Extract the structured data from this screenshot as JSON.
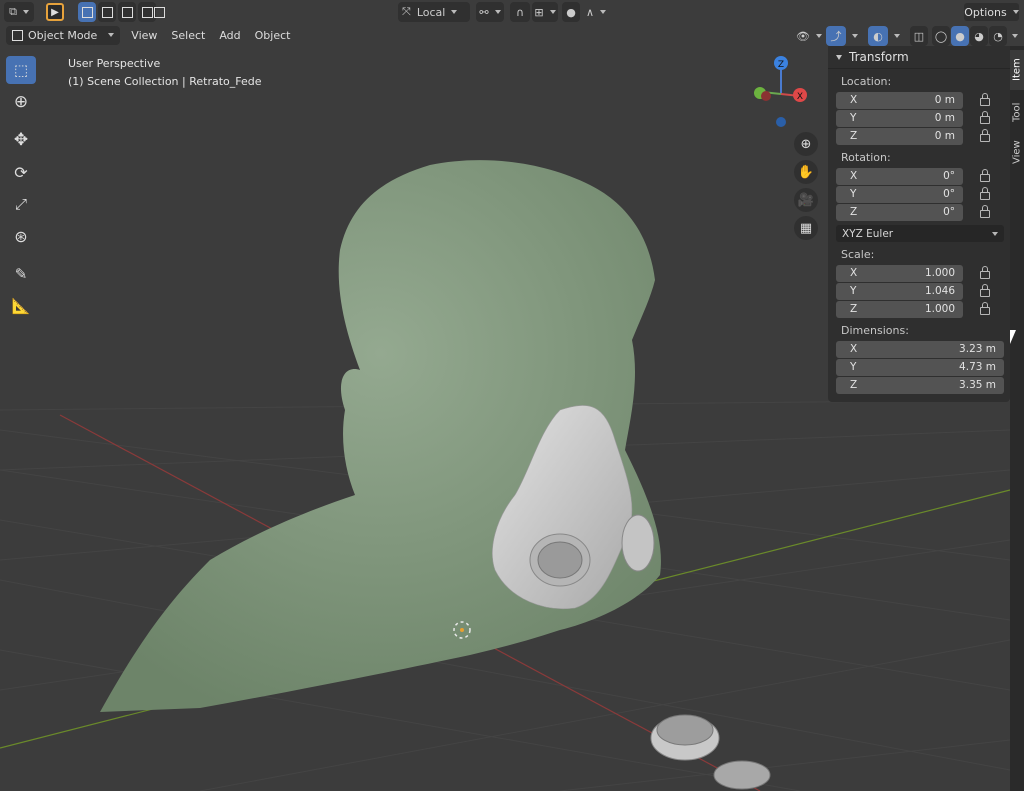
{
  "header": {
    "transform_orientation": "Local",
    "options_label": "Options"
  },
  "menubar": {
    "mode": "Object Mode",
    "items": [
      "View",
      "Select",
      "Add",
      "Object"
    ]
  },
  "overlay": {
    "perspective": "User Perspective",
    "collection": "(1) Scene Collection | Retrato_Fede"
  },
  "gizmo": {
    "z_label": "Z",
    "y_label": "Y",
    "x_label": "X"
  },
  "transform": {
    "title": "Transform",
    "location_label": "Location:",
    "location": [
      {
        "axis": "X",
        "value": "0 m"
      },
      {
        "axis": "Y",
        "value": "0 m"
      },
      {
        "axis": "Z",
        "value": "0 m"
      }
    ],
    "rotation_label": "Rotation:",
    "rotation": [
      {
        "axis": "X",
        "value": "0°"
      },
      {
        "axis": "Y",
        "value": "0°"
      },
      {
        "axis": "Z",
        "value": "0°"
      }
    ],
    "rotation_mode": "XYZ Euler",
    "scale_label": "Scale:",
    "scale": [
      {
        "axis": "X",
        "value": "1.000"
      },
      {
        "axis": "Y",
        "value": "1.046"
      },
      {
        "axis": "Z",
        "value": "1.000"
      }
    ],
    "dimensions_label": "Dimensions:",
    "dimensions": [
      {
        "axis": "X",
        "value": "3.23 m"
      },
      {
        "axis": "Y",
        "value": "4.73 m"
      },
      {
        "axis": "Z",
        "value": "3.35 m"
      }
    ]
  },
  "sidebar_tabs": [
    "Item",
    "Tool",
    "View"
  ],
  "colors": {
    "accent": "#4772b3",
    "mesh": "#7f977c",
    "mask": "#cfcfcf"
  }
}
